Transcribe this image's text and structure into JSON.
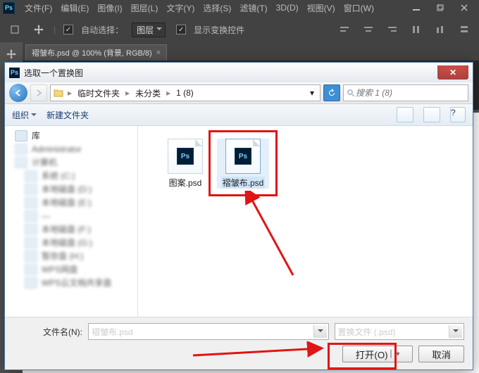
{
  "ps": {
    "menus": [
      "文件(F)",
      "编辑(E)",
      "图像(I)",
      "图层(L)",
      "文字(Y)",
      "选择(S)",
      "滤镜(T)",
      "3D(D)",
      "视图(V)",
      "窗口(W)"
    ],
    "auto_select": "自动选择：",
    "layer_dd": "图层",
    "show_transform": "显示变换控件",
    "doc_tab": "褶皱布.psd @ 100% (背景, RGB/8)"
  },
  "dialog": {
    "title": "选取一个置换图",
    "crumbs": [
      "临时文件夹",
      "未分类",
      "1 (8)"
    ],
    "search_placeholder": "搜索 1 (8)",
    "organize": "组织",
    "new_folder": "新建文件夹",
    "sidebar_first": "库",
    "files": [
      {
        "name": "图案.psd"
      },
      {
        "name": "褶皱布.psd"
      }
    ],
    "filename_label": "文件名(N):",
    "filename_value": "褶皱布.psd",
    "filter_value": "置换文件 (.psd)",
    "open": "打开(O)",
    "cancel": "取消"
  }
}
